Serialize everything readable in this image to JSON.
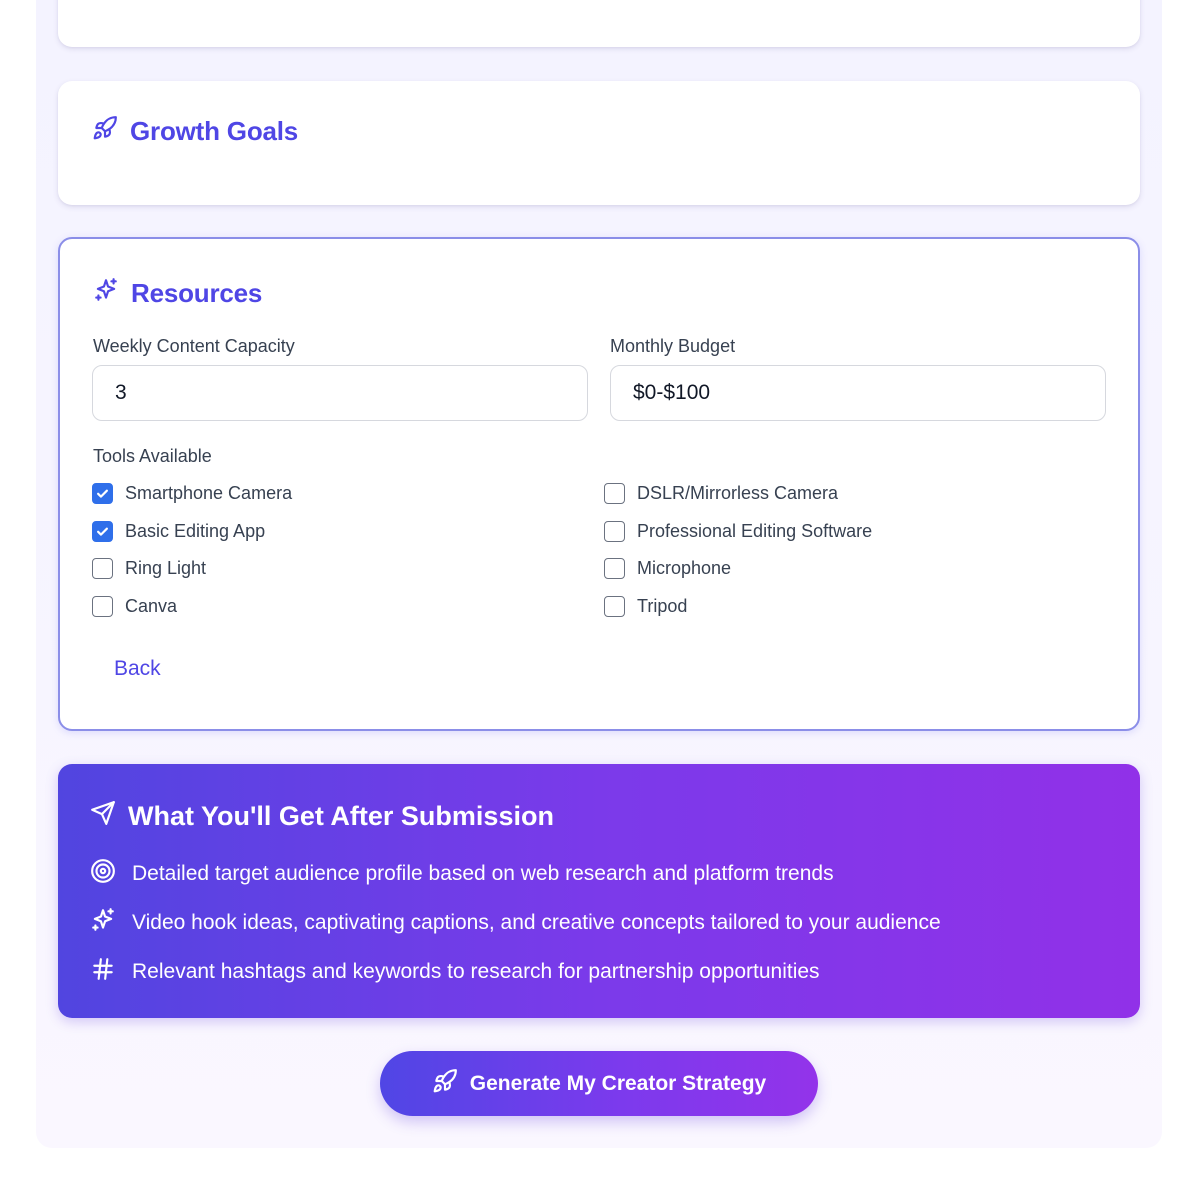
{
  "growth": {
    "title": "Growth Goals",
    "icon": "rocket-icon"
  },
  "resources": {
    "title": "Resources",
    "icon": "sparkles-icon",
    "weekly_label": "Weekly Content Capacity",
    "weekly_value": "3",
    "budget_label": "Monthly Budget",
    "budget_value": "$0-$100",
    "tools_label": "Tools Available",
    "tools": [
      {
        "label": "Smartphone Camera",
        "checked": true
      },
      {
        "label": "DSLR/Mirrorless Camera",
        "checked": false
      },
      {
        "label": "Basic Editing App",
        "checked": true
      },
      {
        "label": "Professional Editing Software",
        "checked": false
      },
      {
        "label": "Ring Light",
        "checked": false
      },
      {
        "label": "Microphone",
        "checked": false
      },
      {
        "label": "Canva",
        "checked": false
      },
      {
        "label": "Tripod",
        "checked": false
      }
    ],
    "back_label": "Back"
  },
  "banner": {
    "title": "What You'll Get After Submission",
    "icon": "send-icon",
    "items": [
      {
        "icon": "target-icon",
        "text": "Detailed target audience profile based on web research and platform trends"
      },
      {
        "icon": "sparkles-icon",
        "text": "Video hook ideas, captivating captions, and creative concepts tailored to your audience"
      },
      {
        "icon": "hash-icon",
        "text": "Relevant hashtags and keywords to research for partnership opportunities"
      }
    ]
  },
  "cta": {
    "label": "Generate My Creator Strategy",
    "icon": "rocket-icon"
  },
  "colors": {
    "accent": "#4f46e5",
    "checkbox": "#2f6fea",
    "gradient_start": "#5145e0",
    "gradient_end": "#9333ea"
  }
}
